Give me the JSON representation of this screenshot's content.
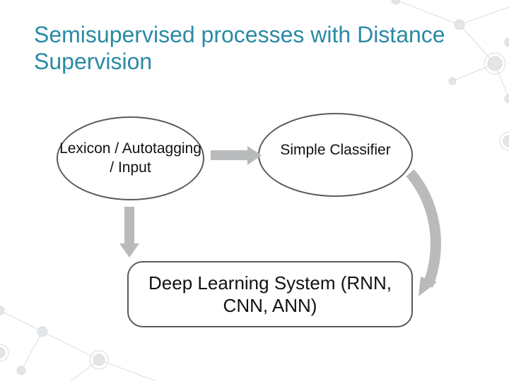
{
  "title": "Semisupervised processes with Distance Supervision",
  "nodes": {
    "lexicon": "Lexicon / Autotagging / Input",
    "classifier": "Simple Classifier",
    "deep": "Deep Learning System (RNN, CNN, ANN)"
  }
}
